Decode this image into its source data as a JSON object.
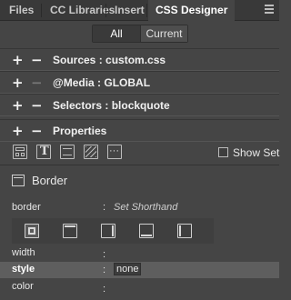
{
  "tabs": [
    "Files",
    "CC Libraries",
    "Insert",
    "CSS Designer"
  ],
  "mode_toggle": {
    "all": "All",
    "current": "Current",
    "selected": "All"
  },
  "sections": {
    "sources": "Sources : custom.css",
    "media": "@Media : GLOBAL",
    "selectors": "Selectors : blockquote",
    "properties": "Properties"
  },
  "category_icons": [
    "layout-icon",
    "text-icon",
    "border-icon",
    "background-icon",
    "more-icon"
  ],
  "show_set": "Show Set",
  "border_section": {
    "title": "Border",
    "border_label": "border",
    "border_value": "Set Shorthand",
    "side_icons": [
      "all-sides-icon",
      "top-side-icon",
      "right-side-icon",
      "bottom-side-icon",
      "left-side-icon"
    ],
    "selected_side": "all-sides-icon",
    "rows": [
      {
        "name": "width",
        "value": ""
      },
      {
        "name": "style",
        "value": "none"
      },
      {
        "name": "color",
        "value": ""
      }
    ]
  }
}
